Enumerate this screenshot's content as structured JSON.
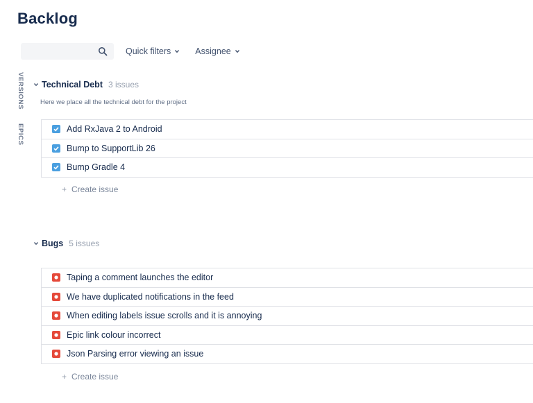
{
  "page": {
    "title": "Backlog"
  },
  "toolbar": {
    "search_placeholder": "",
    "quick_filters_label": "Quick filters",
    "assignee_label": "Assignee"
  },
  "side_tabs": {
    "versions": "VERSIONS",
    "epics": "EPICS"
  },
  "sections": [
    {
      "name": "Technical Debt",
      "count": "3 issues",
      "description": "Here we place all the technical debt for the project",
      "issue_type": "task",
      "issues": [
        {
          "summary": "Add RxJava 2 to Android"
        },
        {
          "summary": "Bump to SupportLib 26"
        },
        {
          "summary": "Bump Gradle 4"
        }
      ],
      "create_label": "Create issue"
    },
    {
      "name": "Bugs",
      "count": "5 issues",
      "issue_type": "bug",
      "issues": [
        {
          "summary": "Taping a comment launches the editor"
        },
        {
          "summary": "We have duplicated notifications in the feed"
        },
        {
          "summary": "When editing labels issue scrolls and it is annoying"
        },
        {
          "summary": "Epic link colour incorrect"
        },
        {
          "summary": "Json Parsing error viewing an issue"
        }
      ],
      "create_label": "Create issue"
    }
  ],
  "colors": {
    "task_icon": "#4a9fe0",
    "bug_icon": "#e5493a",
    "title_text": "#172b4d",
    "muted_text": "#97a0af",
    "border": "#dfe1e6"
  },
  "icons": {
    "search": "search-icon",
    "chevron": "chevron-down-icon",
    "task": "checkbox-task-icon",
    "bug": "bug-icon",
    "plus": "plus-icon"
  }
}
